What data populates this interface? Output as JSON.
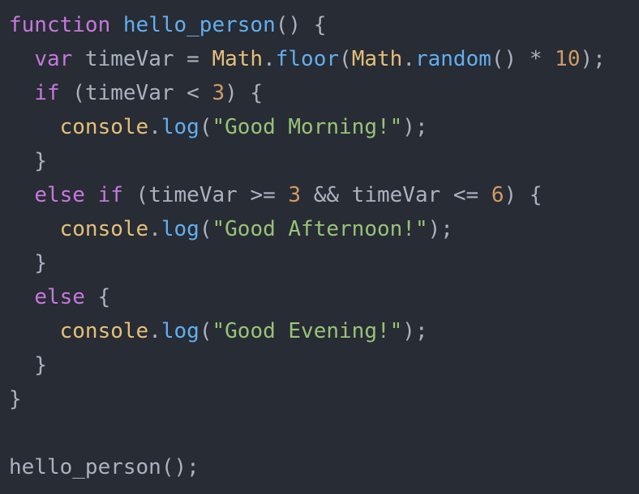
{
  "code": {
    "lines": [
      [
        {
          "t": "function",
          "c": "kw"
        },
        {
          "t": " ",
          "c": "plain"
        },
        {
          "t": "hello_person",
          "c": "fn"
        },
        {
          "t": "() {",
          "c": "plain"
        }
      ],
      [
        {
          "t": "  ",
          "c": "plain"
        },
        {
          "t": "var",
          "c": "kw"
        },
        {
          "t": " timeVar = ",
          "c": "plain"
        },
        {
          "t": "Math",
          "c": "obj"
        },
        {
          "t": ".",
          "c": "plain"
        },
        {
          "t": "floor",
          "c": "meth"
        },
        {
          "t": "(",
          "c": "plain"
        },
        {
          "t": "Math",
          "c": "obj"
        },
        {
          "t": ".",
          "c": "plain"
        },
        {
          "t": "random",
          "c": "meth"
        },
        {
          "t": "() * ",
          "c": "plain"
        },
        {
          "t": "10",
          "c": "num"
        },
        {
          "t": ");",
          "c": "plain"
        }
      ],
      [
        {
          "t": "  ",
          "c": "plain"
        },
        {
          "t": "if",
          "c": "kw"
        },
        {
          "t": " (timeVar < ",
          "c": "plain"
        },
        {
          "t": "3",
          "c": "num"
        },
        {
          "t": ") {",
          "c": "plain"
        }
      ],
      [
        {
          "t": "    ",
          "c": "plain"
        },
        {
          "t": "console",
          "c": "obj"
        },
        {
          "t": ".",
          "c": "plain"
        },
        {
          "t": "log",
          "c": "meth"
        },
        {
          "t": "(",
          "c": "plain"
        },
        {
          "t": "\"Good Morning!\"",
          "c": "str"
        },
        {
          "t": ");",
          "c": "plain"
        }
      ],
      [
        {
          "t": "  }",
          "c": "plain"
        }
      ],
      [
        {
          "t": "  ",
          "c": "plain"
        },
        {
          "t": "else",
          "c": "kw"
        },
        {
          "t": " ",
          "c": "plain"
        },
        {
          "t": "if",
          "c": "kw"
        },
        {
          "t": " (timeVar >= ",
          "c": "plain"
        },
        {
          "t": "3",
          "c": "num"
        },
        {
          "t": " && timeVar <= ",
          "c": "plain"
        },
        {
          "t": "6",
          "c": "num"
        },
        {
          "t": ") {",
          "c": "plain"
        }
      ],
      [
        {
          "t": "    ",
          "c": "plain"
        },
        {
          "t": "console",
          "c": "obj"
        },
        {
          "t": ".",
          "c": "plain"
        },
        {
          "t": "log",
          "c": "meth"
        },
        {
          "t": "(",
          "c": "plain"
        },
        {
          "t": "\"Good Afternoon!\"",
          "c": "str"
        },
        {
          "t": ");",
          "c": "plain"
        }
      ],
      [
        {
          "t": "  }",
          "c": "plain"
        }
      ],
      [
        {
          "t": "  ",
          "c": "plain"
        },
        {
          "t": "else",
          "c": "kw"
        },
        {
          "t": " {",
          "c": "plain"
        }
      ],
      [
        {
          "t": "    ",
          "c": "plain"
        },
        {
          "t": "console",
          "c": "obj"
        },
        {
          "t": ".",
          "c": "plain"
        },
        {
          "t": "log",
          "c": "meth"
        },
        {
          "t": "(",
          "c": "plain"
        },
        {
          "t": "\"Good Evening!\"",
          "c": "str"
        },
        {
          "t": ");",
          "c": "plain"
        }
      ],
      [
        {
          "t": "  }",
          "c": "plain"
        }
      ],
      [
        {
          "t": "}",
          "c": "plain"
        }
      ],
      [],
      [
        {
          "t": "hello_person",
          "c": "plain"
        },
        {
          "t": "();",
          "c": "plain"
        }
      ]
    ]
  },
  "theme": {
    "background": "#282c34",
    "keyword": "#c678dd",
    "function": "#61afef",
    "object": "#e5c07b",
    "number": "#d19a66",
    "string": "#98c379",
    "text": "#abb2bf"
  }
}
